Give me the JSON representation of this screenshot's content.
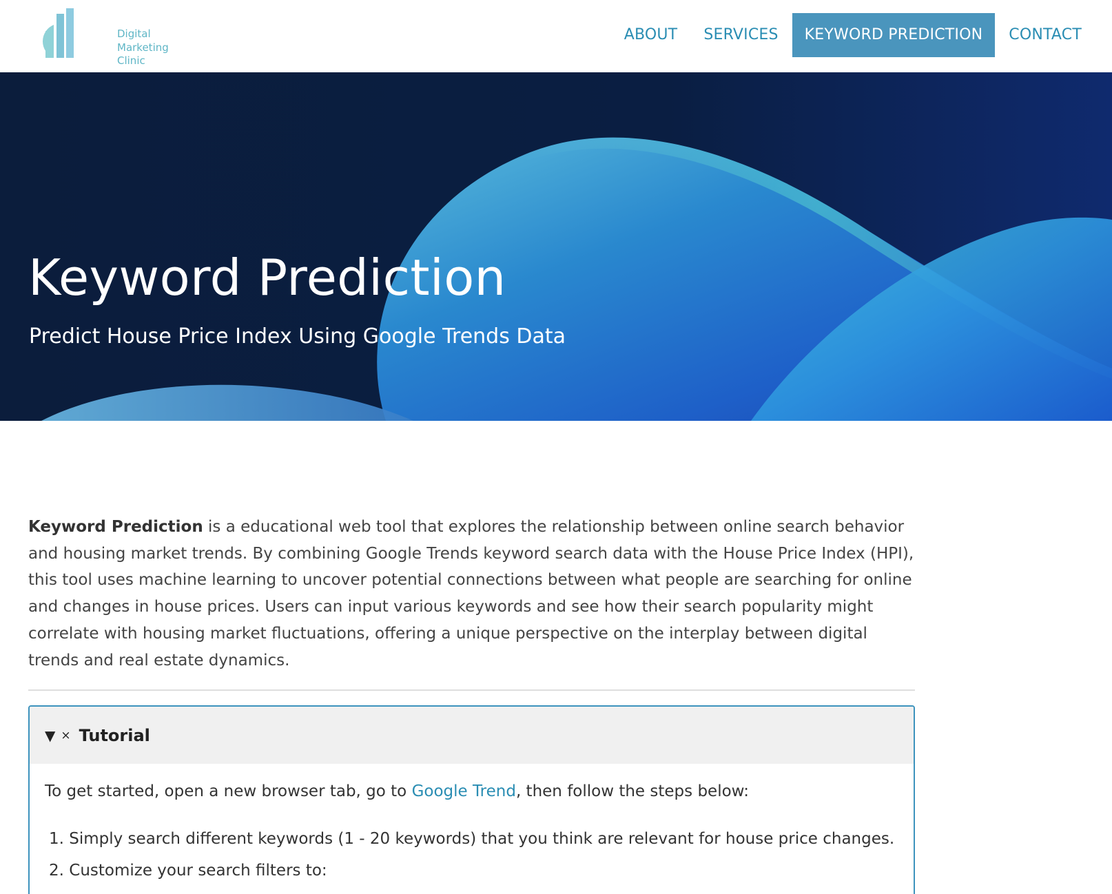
{
  "header": {
    "logo_lines": [
      "Digital",
      "Marketing",
      "Clinic"
    ],
    "nav": [
      {
        "label": "ABOUT",
        "active": false
      },
      {
        "label": "SERVICES",
        "active": false
      },
      {
        "label": "KEYWORD PREDICTION",
        "active": true
      },
      {
        "label": "CONTACT",
        "active": false
      }
    ]
  },
  "hero": {
    "title": "Keyword Prediction",
    "subtitle": "Predict House Price Index Using Google Trends Data"
  },
  "intro": {
    "bold": "Keyword Prediction",
    "text": " is a educational web tool that explores the relationship between online search behavior and housing market trends. By combining Google Trends keyword search data with the House Price Index (HPI), this tool uses machine learning to uncover potential connections between what people are searching for online and changes in house prices. Users can input various keywords and see how their search popularity might correlate with housing market fluctuations, offering a unique perspective on the interplay between digital trends and real estate dynamics."
  },
  "tutorial": {
    "title": "Tutorial",
    "lead_before": "To get started, open a new browser tab, go to ",
    "lead_link": "Google Trend",
    "lead_after": ", then follow the steps below:",
    "steps": [
      "1. Simply search different keywords (1 - 20 keywords) that you think are relevant for house price changes.",
      "2. Customize your search filters to:"
    ]
  },
  "colors": {
    "accent": "#2a8db3",
    "nav_active_bg": "#4a95bd",
    "hero_bg": "#0a1b3a",
    "tutorial_border": "#3d93bd"
  },
  "icons": [
    "logo-bars-icon",
    "triangle-down-icon",
    "close-x-icon"
  ]
}
